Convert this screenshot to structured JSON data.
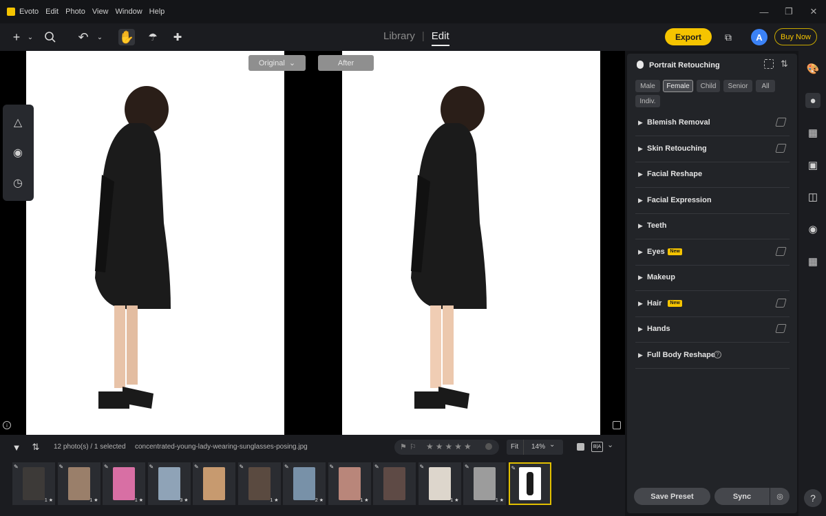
{
  "app": {
    "name": "Evoto"
  },
  "menu": [
    "Edit",
    "Photo",
    "View",
    "Window",
    "Help"
  ],
  "tabs": {
    "library": "Library",
    "edit": "Edit"
  },
  "toolbar": {
    "export_label": "Export",
    "avatar_letter": "A",
    "buy_label": "Buy Now"
  },
  "compare": {
    "original_label": "Original",
    "after_label": "After"
  },
  "filmstrip": {
    "count_text": "12 photo(s) / 1 selected",
    "filename": "concentrated-young-lady-wearing-sunglasses-posing.jpg",
    "fit_label": "Fit",
    "zoom": "14%",
    "ba_label": "B|A",
    "thumbnails": [
      {
        "rating": "1 ★",
        "color": "#3d3a38"
      },
      {
        "rating": "1 ★",
        "color": "#9a7f6a"
      },
      {
        "rating": "1 ★",
        "color": "#d86fa4"
      },
      {
        "rating": "3 ★",
        "color": "#8fa3b7"
      },
      {
        "rating": "",
        "color": "#c79a6f"
      },
      {
        "rating": "1 ★",
        "color": "#5a4a40"
      },
      {
        "rating": "2 ★",
        "color": "#7891a8"
      },
      {
        "rating": "1 ★",
        "color": "#b9867a"
      },
      {
        "rating": "",
        "color": "#5e4a45"
      },
      {
        "rating": "1 ★",
        "color": "#ddd6cc"
      },
      {
        "rating": "1 ★",
        "color": "#9c9c9c"
      },
      {
        "rating": "",
        "color": "#2b2b2b"
      }
    ]
  },
  "panel": {
    "title": "Portrait Retouching",
    "chips": [
      {
        "label": "Male",
        "selected": false
      },
      {
        "label": "Female",
        "selected": true
      },
      {
        "label": "Child",
        "selected": false
      },
      {
        "label": "Senior",
        "selected": false
      },
      {
        "label": "All",
        "selected": false
      },
      {
        "label": "Indiv.",
        "selected": false
      }
    ],
    "sections": [
      {
        "label": "Blemish Removal",
        "badge": "",
        "eraser": true
      },
      {
        "label": "Skin Retouching",
        "badge": "",
        "eraser": true
      },
      {
        "label": "Facial Reshape",
        "badge": "",
        "eraser": false
      },
      {
        "label": "Facial Expression",
        "badge": "",
        "eraser": false
      },
      {
        "label": "Teeth",
        "badge": "",
        "eraser": false
      },
      {
        "label": "Eyes",
        "badge": "New",
        "eraser": true
      },
      {
        "label": "Makeup",
        "badge": "",
        "eraser": false
      },
      {
        "label": "Hair",
        "badge": "New",
        "eraser": true
      },
      {
        "label": "Hands",
        "badge": "",
        "eraser": true
      },
      {
        "label": "Full Body Reshape",
        "badge": "",
        "eraser": false,
        "help": true
      }
    ],
    "save_preset_label": "Save Preset",
    "sync_label": "Sync"
  }
}
